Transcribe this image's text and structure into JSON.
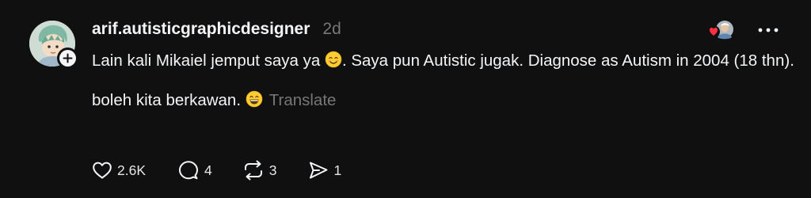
{
  "post": {
    "username": "arif.autisticgraphicdesigner",
    "timestamp": "2d",
    "paragraph1": {
      "text_a": "Lain kali Mikaiel jemput saya ya ",
      "emoji_a": "smiling-face-emoji",
      "text_b": ". Saya pun Autistic jugak. Diagnose as Autism in 2004 (18 thn)."
    },
    "paragraph2": {
      "text_a": "boleh kita berkawan. ",
      "emoji_a": "grinning-face-emoji"
    },
    "translate_label": "Translate"
  },
  "actions": {
    "likes": "2.6K",
    "replies": "4",
    "reposts": "3",
    "shares": "1"
  },
  "colors": {
    "background": "#101010",
    "text_primary": "#f3f5f7",
    "text_secondary": "#777777",
    "like_heart": "#ff3040"
  },
  "icons": [
    "follow-plus-icon",
    "heart-icon",
    "reply-icon",
    "repost-icon",
    "share-icon",
    "more-icon"
  ]
}
